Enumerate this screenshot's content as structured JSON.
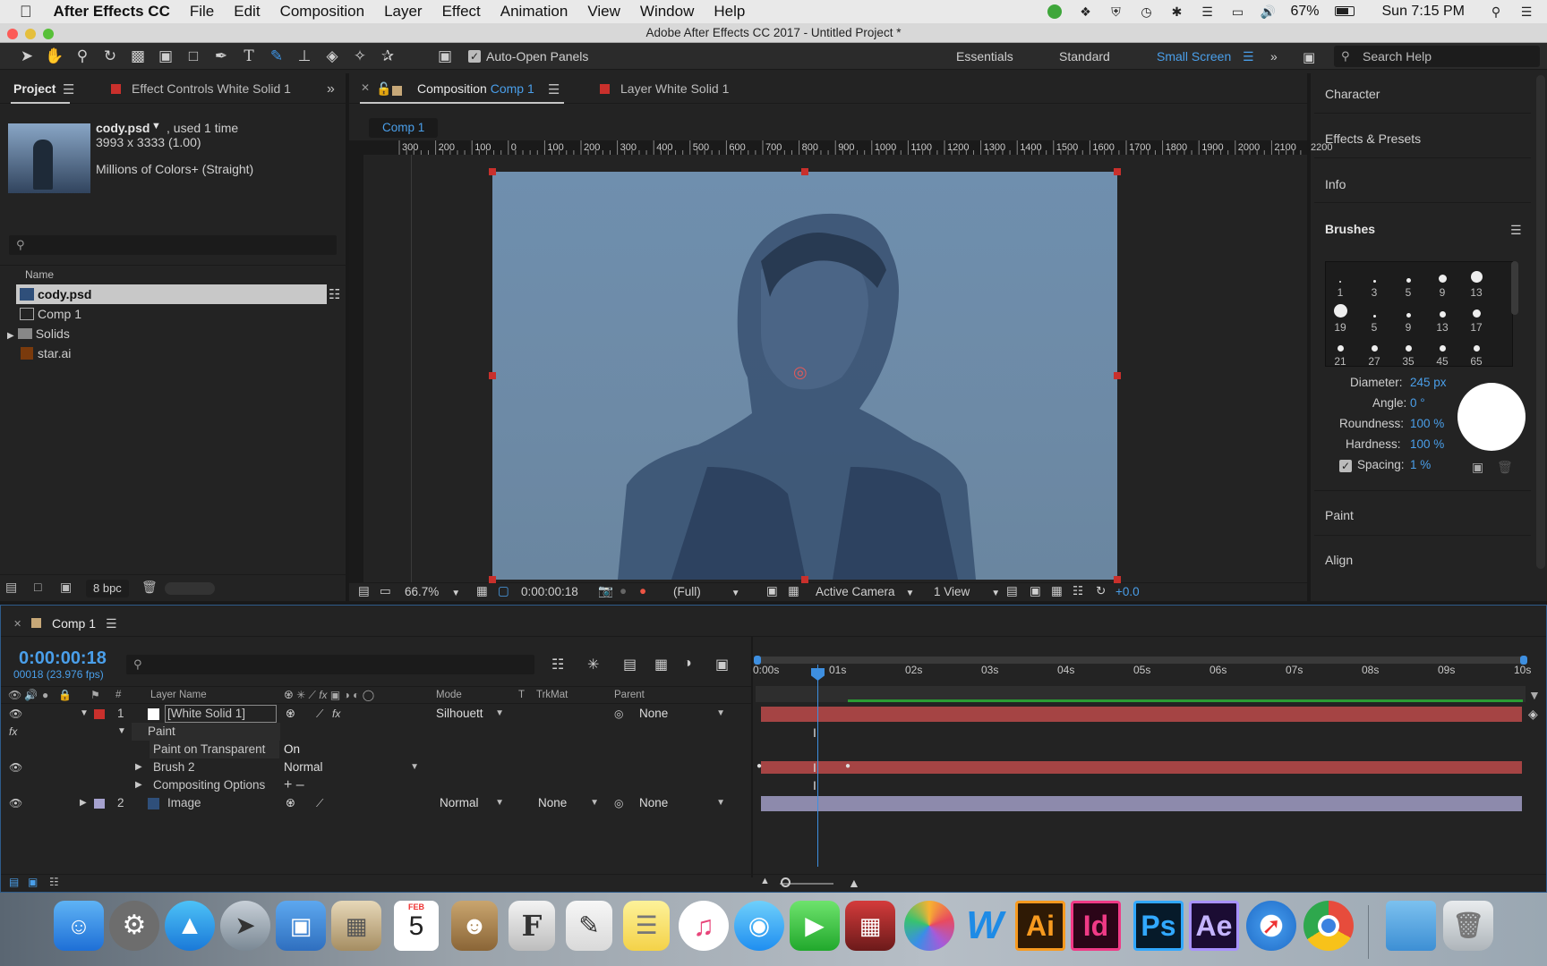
{
  "menubar": {
    "app": "After Effects CC",
    "items": [
      "File",
      "Edit",
      "Composition",
      "Layer",
      "Effect",
      "Animation",
      "View",
      "Window",
      "Help"
    ],
    "battery": "67%",
    "clock": "Sun 7:15 PM"
  },
  "window_title": "Adobe After Effects CC 2017 - Untitled Project *",
  "toolbar": {
    "auto_open": "Auto-Open Panels",
    "workspaces": [
      "Essentials",
      "Standard",
      "Small Screen"
    ],
    "search_placeholder": "Search Help"
  },
  "project_panel": {
    "tab_project": "Project",
    "tab_effect_controls": "Effect Controls White Solid 1",
    "asset_name": "cody.psd",
    "asset_usage": ", used 1 time",
    "asset_dims": "3993 x 3333 (1.00)",
    "asset_colors": "Millions of Colors+ (Straight)",
    "col_name": "Name",
    "items": [
      "cody.psd",
      "Comp 1",
      "Solids",
      "star.ai"
    ],
    "bpc": "8 bpc"
  },
  "comp_panel": {
    "tab_composition": "Composition",
    "tab_comp_name": "Comp 1",
    "tab_layer": "Layer White Solid 1",
    "subtab": "Comp 1",
    "ruler_labels": [
      "300",
      "200",
      "100",
      "0",
      "100",
      "200",
      "300",
      "400",
      "500",
      "600",
      "700",
      "800",
      "900",
      "1000",
      "1100",
      "1200",
      "1300",
      "1400",
      "1500",
      "1600",
      "1700",
      "1800",
      "1900",
      "2000",
      "2100",
      "2200"
    ],
    "zoom": "66.7%",
    "timecode": "0:00:00:18",
    "resolution": "(Full)",
    "camera": "Active Camera",
    "views": "1 View",
    "exposure": "+0.0"
  },
  "right_panel": {
    "character": "Character",
    "effects_presets": "Effects & Presets",
    "info": "Info",
    "brushes": "Brushes",
    "brush_sizes": [
      "1",
      "3",
      "5",
      "9",
      "13",
      "19",
      "5",
      "9",
      "13",
      "17",
      "21",
      "27",
      "35",
      "45",
      "65"
    ],
    "diameter_label": "Diameter:",
    "diameter_value": "245 px",
    "angle_label": "Angle:",
    "angle_value": "0 °",
    "roundness_label": "Roundness:",
    "roundness_value": "100 %",
    "hardness_label": "Hardness:",
    "hardness_value": "100 %",
    "spacing_label": "Spacing:",
    "spacing_value": "1 %",
    "paint": "Paint",
    "align": "Align"
  },
  "timeline": {
    "tab": "Comp 1",
    "timecode": "0:00:00:18",
    "frames": "00018 (23.976 fps)",
    "headers": {
      "num": "#",
      "layer_name": "Layer Name",
      "mode": "Mode",
      "t": "T",
      "trkmat": "TrkMat",
      "parent": "Parent"
    },
    "layer1": {
      "num": "1",
      "name": "[White Solid 1]",
      "mode": "Silhouett",
      "parent": "None"
    },
    "paint": "Paint",
    "paint_on_transparent": "Paint on Transparent",
    "paint_on_transparent_value": "On",
    "brush2": "Brush 2",
    "brush2_mode": "Normal",
    "compositing_options": "Compositing Options",
    "layer2": {
      "num": "2",
      "name": "Image",
      "mode": "Normal",
      "trkmat": "None",
      "parent": "None"
    },
    "ticks": [
      "0:00s",
      "01s",
      "02s",
      "03s",
      "04s",
      "05s",
      "06s",
      "07s",
      "08s",
      "09s",
      "10s"
    ]
  },
  "dock_labels": {
    "ai": "Ai",
    "id": "Id",
    "ps": "Ps",
    "ae": "Ae",
    "word": "W",
    "calendar_month": "FEB",
    "calendar_day": "5"
  }
}
